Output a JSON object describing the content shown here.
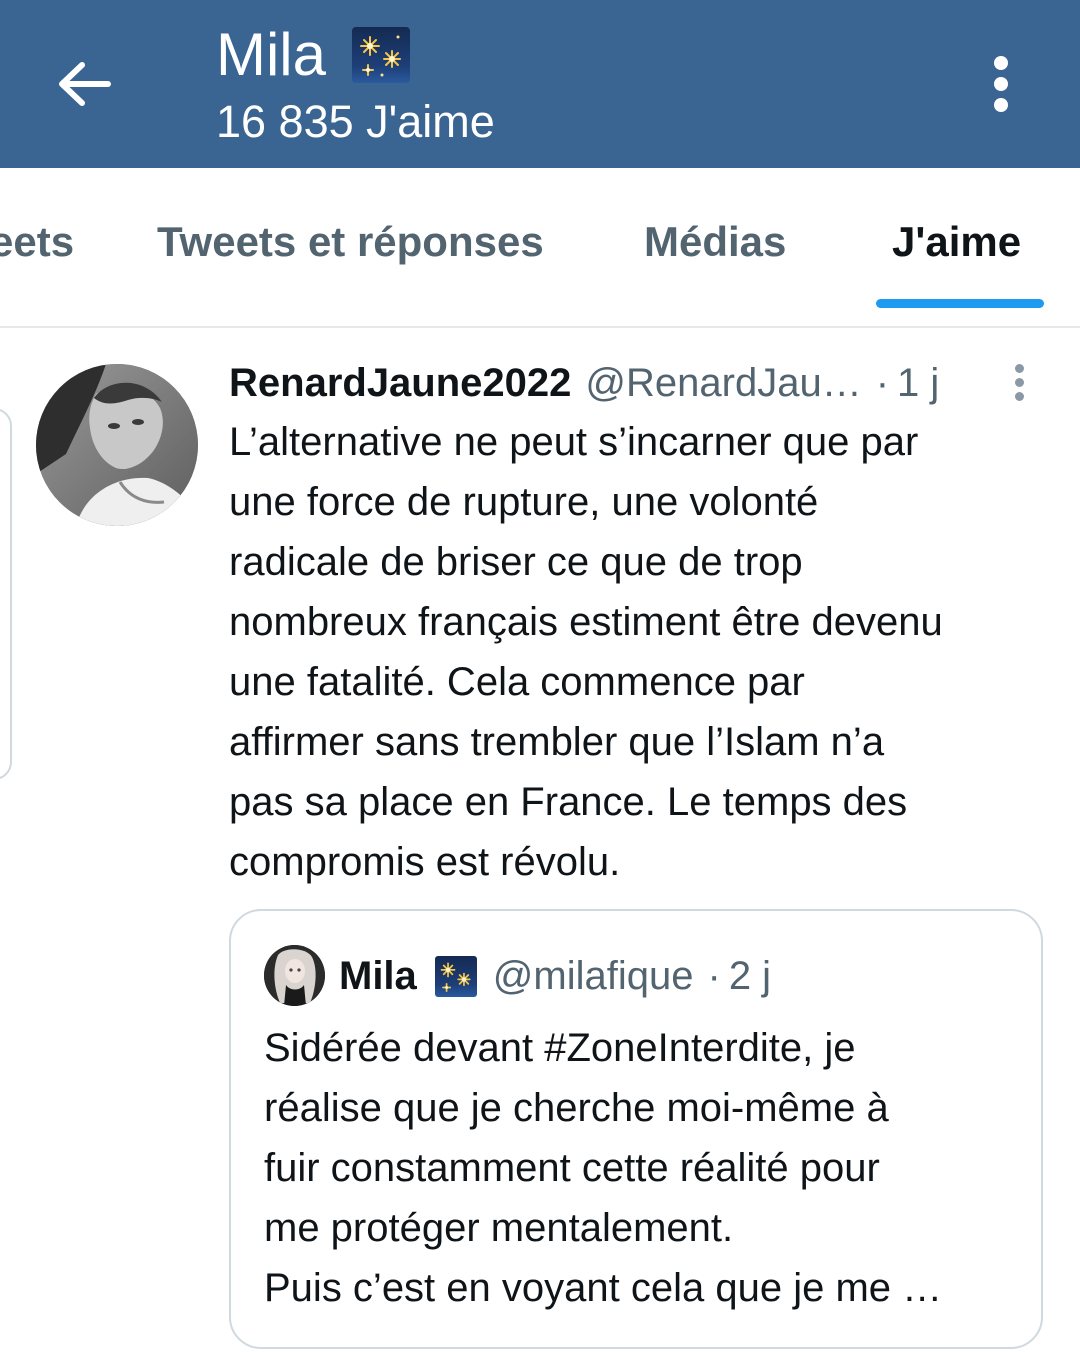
{
  "header": {
    "back_icon": "arrow-left-icon",
    "title": "Mila",
    "title_emoji": "sparkler-icon",
    "subtitle": "16 835 J'aime",
    "more_icon": "more-vertical-icon",
    "background_color": "#3a6491"
  },
  "tabs": {
    "items": [
      {
        "label": "eets"
      },
      {
        "label": "Tweets et réponses"
      },
      {
        "label": "Médias"
      },
      {
        "label": "J'aime"
      }
    ],
    "active_index": 3,
    "accent_color": "#1d9bf0"
  },
  "tweet": {
    "author_name": "RenardJaune2022",
    "author_handle": "@RenardJau…",
    "separator": "·",
    "time": "1 j",
    "text_lines": [
      "L’alternative ne peut s’incarner que par",
      "une force de rupture, une volonté",
      "radicale de briser ce que de trop",
      "nombreux français estiment être devenu",
      "une fatalité. Cela commence par",
      "affirmer sans trembler que l’Islam n’a",
      "pas sa place en France. Le temps des",
      "compromis est révolu."
    ],
    "quote": {
      "author_name": "Mila",
      "author_emoji": "sparkler-icon",
      "author_handle": "@milafique",
      "separator": "·",
      "time": "2 j",
      "text_lines": [
        "Sidérée devant #ZoneInterdite, je",
        "réalise que je cherche moi-même à",
        "fuir constamment cette réalité pour",
        "me protéger mentalement.",
        "Puis c’est en voyant cela que je me …"
      ]
    }
  }
}
